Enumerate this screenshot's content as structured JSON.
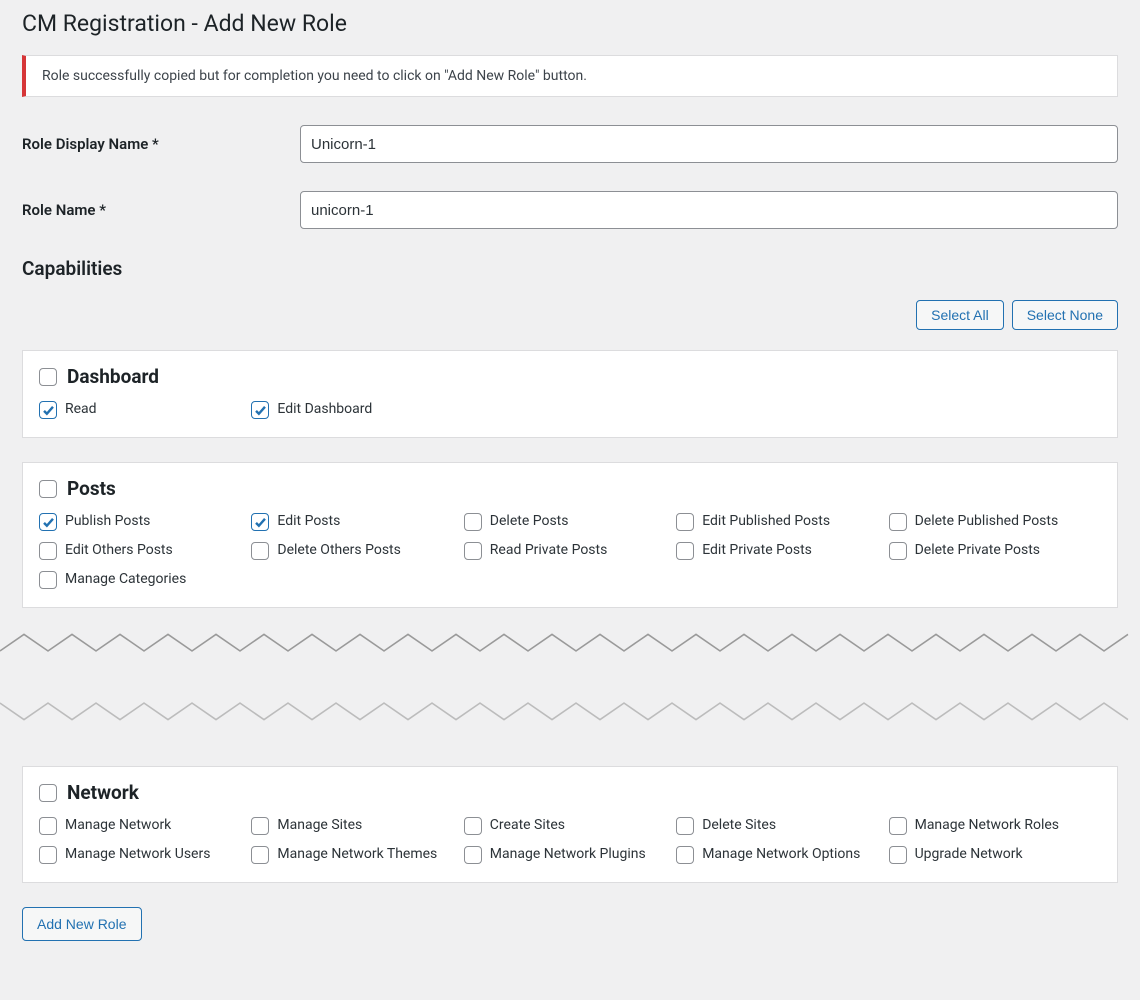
{
  "page_title": "CM Registration - Add New Role",
  "notice_text": "Role successfully copied but for completion you need to click on \"Add New Role\" button.",
  "fields": {
    "display_name": {
      "label": "Role Display Name *",
      "value": "Unicorn-1"
    },
    "role_name": {
      "label": "Role Name *",
      "value": "unicorn-1"
    }
  },
  "capabilities_heading": "Capabilities",
  "buttons": {
    "select_all": "Select All",
    "select_none": "Select None",
    "submit": "Add New Role"
  },
  "groups": [
    {
      "title": "Dashboard",
      "caps": [
        {
          "label": "Read",
          "checked": true
        },
        {
          "label": "Edit Dashboard",
          "checked": true
        }
      ]
    },
    {
      "title": "Posts",
      "caps": [
        {
          "label": "Publish Posts",
          "checked": true
        },
        {
          "label": "Edit Posts",
          "checked": true
        },
        {
          "label": "Delete Posts",
          "checked": false
        },
        {
          "label": "Edit Published Posts",
          "checked": false
        },
        {
          "label": "Delete Published Posts",
          "checked": false
        },
        {
          "label": "Edit Others Posts",
          "checked": false
        },
        {
          "label": "Delete Others Posts",
          "checked": false
        },
        {
          "label": "Read Private Posts",
          "checked": false
        },
        {
          "label": "Edit Private Posts",
          "checked": false
        },
        {
          "label": "Delete Private Posts",
          "checked": false
        },
        {
          "label": "Manage Categories",
          "checked": false
        }
      ]
    },
    {
      "title": "Network",
      "caps": [
        {
          "label": "Manage Network",
          "checked": false
        },
        {
          "label": "Manage Sites",
          "checked": false
        },
        {
          "label": "Create Sites",
          "checked": false
        },
        {
          "label": "Delete Sites",
          "checked": false
        },
        {
          "label": "Manage Network Roles",
          "checked": false
        },
        {
          "label": "Manage Network Users",
          "checked": false
        },
        {
          "label": "Manage Network Themes",
          "checked": false
        },
        {
          "label": "Manage Network Plugins",
          "checked": false
        },
        {
          "label": "Manage Network Options",
          "checked": false
        },
        {
          "label": "Upgrade Network",
          "checked": false
        }
      ]
    }
  ]
}
